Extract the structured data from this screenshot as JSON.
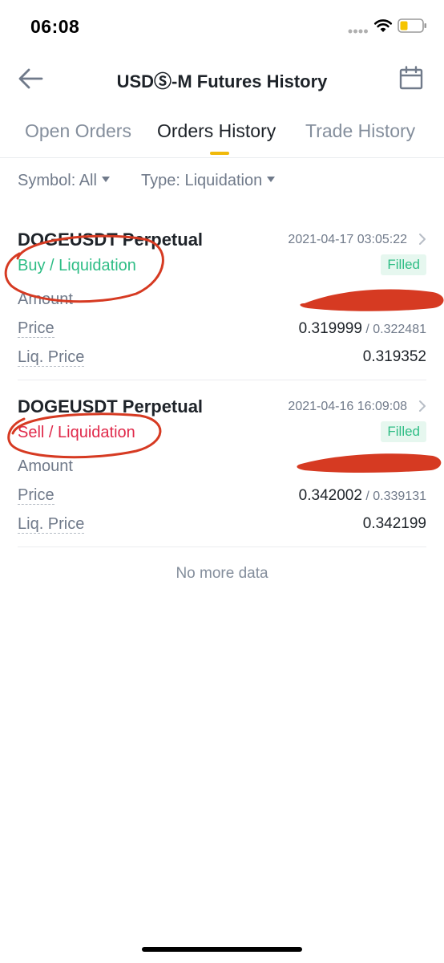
{
  "status_bar": {
    "time": "06:08"
  },
  "header": {
    "title": "USDⓈ-M Futures History"
  },
  "tabs": [
    {
      "label": "Open Orders"
    },
    {
      "label": "Orders History",
      "active": true
    },
    {
      "label": "Trade History"
    }
  ],
  "filters": {
    "symbol_label": "Symbol: All",
    "type_label": "Type: Liquidation"
  },
  "orders": [
    {
      "symbol": "DOGEUSDT Perpetual",
      "datetime": "2021-04-17 03:05:22",
      "side": "Buy / Liquidation",
      "status": "Filled",
      "amount_label": "Amount",
      "price_label": "Price",
      "price": "0.319999",
      "avg_price": " / 0.322481",
      "liq_label": "Liq. Price",
      "liq_price": "0.319352"
    },
    {
      "symbol": "DOGEUSDT Perpetual",
      "datetime": "2021-04-16 16:09:08",
      "side": "Sell / Liquidation",
      "status": "Filled",
      "amount_label": "Amount",
      "price_label": "Price",
      "price": "0.342002",
      "avg_price": " / 0.339131",
      "liq_label": "Liq. Price",
      "liq_price": "0.342199"
    }
  ],
  "footer": {
    "no_more": "No more data"
  },
  "colors": {
    "accent": "#f0b90b",
    "buy": "#2ebd85",
    "sell": "#e0294a",
    "annotation": "#d63a22"
  }
}
